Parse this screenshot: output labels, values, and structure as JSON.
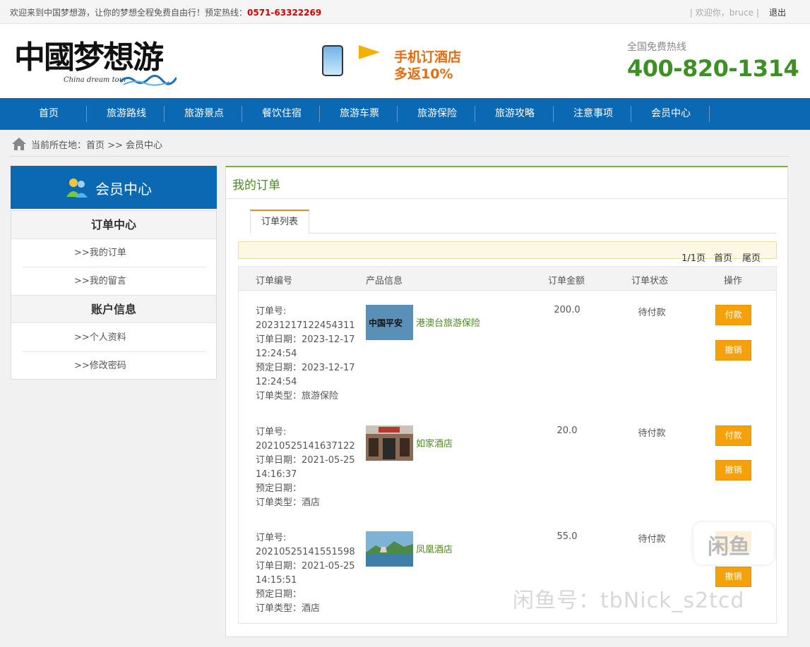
{
  "topbar": {
    "welcome": "欢迎来到中国梦想游，让你的梦想全程免费自由行！预定热线：",
    "hotline": "0571-63322269",
    "greeting": "欢迎你，bruce",
    "logout": "退出"
  },
  "header": {
    "logo_text": "中國梦想游",
    "logo_sub": "China dream tour",
    "promo_line1": "手机订酒店",
    "promo_line2": "多返10%",
    "hotline_label": "全国免费热线",
    "hotline_number": "400-820-1314"
  },
  "nav": {
    "items": [
      "首页",
      "旅游路线",
      "旅游景点",
      "餐饮住宿",
      "旅游车票",
      "旅游保险",
      "旅游攻略",
      "注意事项",
      "会员中心"
    ]
  },
  "breadcrumb": {
    "text": "当前所在地：首页 >> 会员中心"
  },
  "sidebar": {
    "title": "会员中心",
    "sections": [
      {
        "title": "订单中心",
        "links": [
          ">>我的订单",
          ">>我的留言"
        ]
      },
      {
        "title": "账户信息",
        "links": [
          ">>个人资料",
          ">>修改密码"
        ]
      }
    ]
  },
  "main": {
    "title": "我的订单",
    "tab": "订单列表",
    "pager": {
      "info": "1/1页",
      "first": "首页",
      "last": "尾页"
    },
    "columns": [
      "订单编号",
      "产品信息",
      "订单金额",
      "订单状态",
      "操作"
    ],
    "orders": [
      {
        "no_label": "订单号:",
        "no": "20231217122454311",
        "order_date_label": "订单日期：",
        "order_date": "2023-12-17",
        "order_time": "12:24:54",
        "book_date_label": "预定日期：",
        "book_date": "2023-12-17",
        "book_time": "12:24:54",
        "type_label": "订单类型：",
        "type": "旅游保险",
        "product_name": "港澳台旅游保险",
        "product_img_text": "中国平安",
        "amount": "200.0",
        "status": "待付款",
        "pay": "付款",
        "cancel": "撤销"
      },
      {
        "no_label": "订单号:",
        "no": "20210525141637122",
        "order_date_label": "订单日期：",
        "order_date": "2021-05-25",
        "order_time": "14:16:37",
        "book_date_label": "预定日期：",
        "book_date": "",
        "book_time": "",
        "type_label": "订单类型：",
        "type": "酒店",
        "product_name": "如家酒店",
        "amount": "20.0",
        "status": "待付款",
        "pay": "付款",
        "cancel": "撤销"
      },
      {
        "no_label": "订单号:",
        "no": "20210525141551598",
        "order_date_label": "订单日期：",
        "order_date": "2021-05-25",
        "order_time": "14:15:51",
        "book_date_label": "预定日期：",
        "book_date": "",
        "book_time": "",
        "type_label": "订单类型：",
        "type": "酒店",
        "product_name": "凤凰酒店",
        "amount": "55.0",
        "status": "待付款",
        "pay": "付款",
        "cancel": "撤销"
      }
    ]
  },
  "watermark": {
    "text": "闲鱼号：tbNick_s2tcd",
    "badge": "闲鱼"
  },
  "colors": {
    "nav_blue": "#0b68b2",
    "accent_green": "#4a8c1c",
    "button_orange": "#f6a10a",
    "hotline_red": "#cc0000"
  }
}
